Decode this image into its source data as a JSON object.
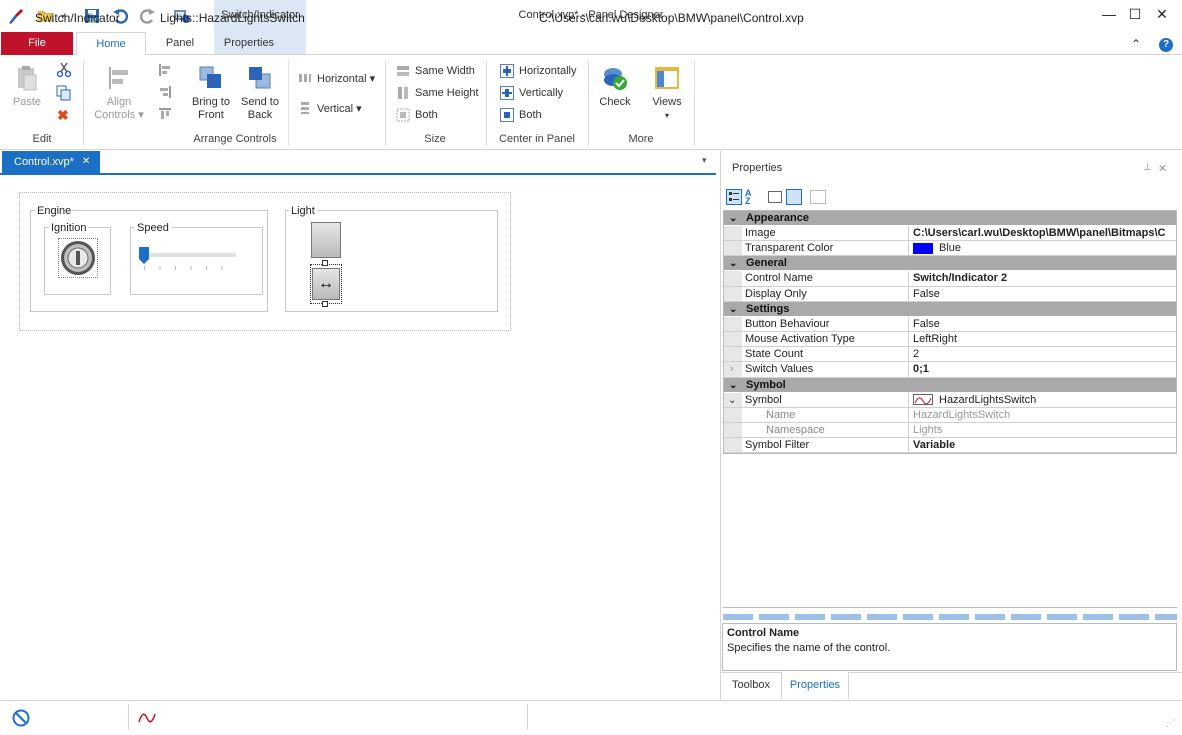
{
  "titlebar": {
    "title": "Control.xvp* - Panel Designer",
    "context_tab": "Switch/Indicator"
  },
  "ribbon_tabs": [
    "File",
    "Home",
    "Panel",
    "Properties"
  ],
  "ribbon": {
    "edit": {
      "paste": "Paste",
      "group": "Edit"
    },
    "arrange": {
      "align": "Align",
      "align2": "Controls ▾",
      "bring1": "Bring to",
      "bring2": "Front",
      "send1": "Send to",
      "send2": "Back",
      "horizontal": "Horizontal ▾",
      "vertical": "Vertical ▾",
      "group": "Arrange Controls"
    },
    "size": {
      "same_width": "Same Width",
      "same_height": "Same Height",
      "both": "Both",
      "group": "Size"
    },
    "center": {
      "horizontally": "Horizontally",
      "vertically": "Vertically",
      "both": "Both",
      "group": "Center in Panel"
    },
    "more": {
      "check": "Check",
      "views": "Views",
      "views_arrow": "▾",
      "group": "More"
    }
  },
  "document": {
    "tab": "Control.xvp*",
    "tab_close": "✕",
    "groups": {
      "engine": "Engine",
      "ignition": "Ignition",
      "speed": "Speed",
      "light": "Light"
    }
  },
  "properties": {
    "title": "Properties",
    "categories": {
      "appearance": "Appearance",
      "general": "General",
      "settings": "Settings",
      "symbol": "Symbol"
    },
    "rows": {
      "image": {
        "name": "Image",
        "value": "C:\\Users\\carl.wu\\Desktop\\BMW\\panel\\Bitmaps\\C"
      },
      "transparent": {
        "name": "Transparent Color",
        "value": "Blue"
      },
      "control_name": {
        "name": "Control Name",
        "value": "Switch/Indicator 2"
      },
      "display_only": {
        "name": "Display Only",
        "value": "False"
      },
      "button_behaviour": {
        "name": "Button Behaviour",
        "value": "False"
      },
      "mouse_activation": {
        "name": "Mouse Activation Type",
        "value": "LeftRight"
      },
      "state_count": {
        "name": "State Count",
        "value": "2"
      },
      "switch_values": {
        "name": "Switch Values",
        "value": "0;1"
      },
      "symbol": {
        "name": "Symbol",
        "value": "HazardLightsSwitch"
      },
      "sym_name": {
        "name": "Name",
        "value": "HazardLightsSwitch"
      },
      "sym_namespace": {
        "name": "Namespace",
        "value": "Lights"
      },
      "symbol_filter": {
        "name": "Symbol Filter",
        "value": "Variable"
      }
    },
    "desc_title": "Control Name",
    "desc_text": "Specifies the name of the control.",
    "bottom_tabs": [
      "Toolbox",
      "Properties"
    ]
  },
  "status": {
    "item1": "Switch/Indicator",
    "item2": "Lights::HazardLightsSwitch",
    "path": "C:\\Users\\carl.wu\\Desktop\\BMW\\panel\\Control.xvp"
  },
  "colors": {
    "accent": "#1b6fc4",
    "file": "#c0122a",
    "transparent_swatch": "#0000ff"
  }
}
